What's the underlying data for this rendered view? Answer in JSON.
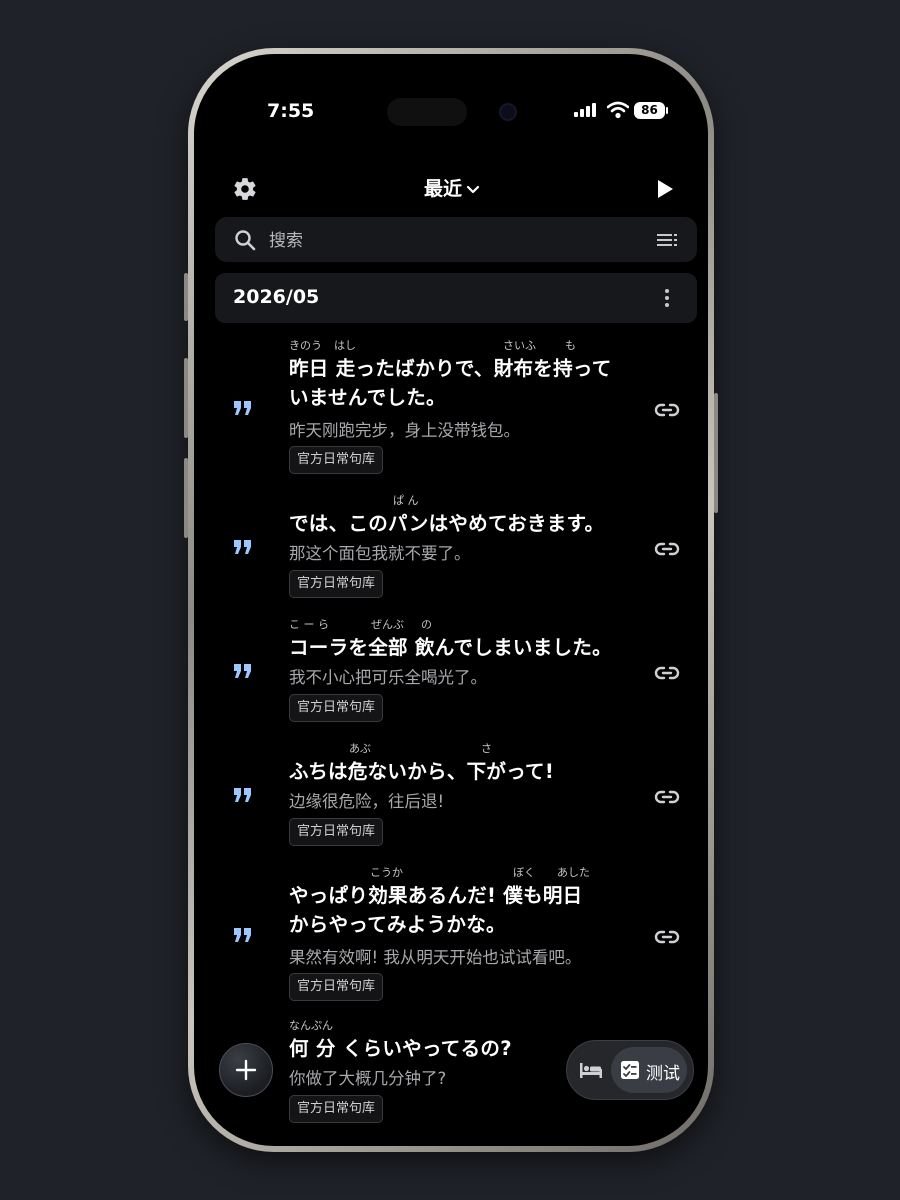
{
  "status_bar": {
    "time": "7:55",
    "battery": "86"
  },
  "header": {
    "title": "最近"
  },
  "search": {
    "placeholder": "搜索"
  },
  "month": {
    "label": "2026/05"
  },
  "sentences": [
    {
      "ruby": [
        "きのう",
        "はし",
        "さいふ",
        "も"
      ],
      "jp_lines": [
        "昨日 走ったばかりで、財布を持って",
        "いませんでした。"
      ],
      "zh": "昨天刚跑完步，身上没带钱包。",
      "tag": "官方日常句库"
    },
    {
      "ruby": [
        "ぱ ん"
      ],
      "jp_lines": [
        "では、このパンはやめておきます。"
      ],
      "zh": "那这个面包我就不要了。",
      "tag": "官方日常句库"
    },
    {
      "ruby": [
        "こ ー ら",
        "ぜんぶ",
        "の"
      ],
      "jp_lines": [
        "コーラを全部 飲んでしまいました。"
      ],
      "zh": "我不小心把可乐全喝光了。",
      "tag": "官方日常句库"
    },
    {
      "ruby": [
        "あぶ",
        "さ"
      ],
      "jp_lines": [
        "ふちは危ないから、下がって!"
      ],
      "zh": "边缘很危险，往后退!",
      "tag": "官方日常句库"
    },
    {
      "ruby": [
        "こうか",
        "ぼく",
        "あした"
      ],
      "jp_lines": [
        "やっぱり効果あるんだ! 僕も明日",
        "からやってみようかな。"
      ],
      "zh": "果然有效啊! 我从明天开始也试试看吧。",
      "tag": "官方日常句库"
    },
    {
      "ruby": [
        "なんぷん"
      ],
      "jp_lines": [
        "何 分 くらいやってるの?"
      ],
      "zh": "你做了大概几分钟了?",
      "tag": "官方日常句库"
    }
  ],
  "bottom": {
    "test_label": "测试"
  },
  "icons": {
    "settings": "gear-icon",
    "title_dropdown": "chevron-down-icon",
    "play": "play-icon",
    "search": "search-icon",
    "list": "list-icon",
    "more": "more-vertical-icon",
    "quote": "quote-icon",
    "link": "link-icon",
    "add": "plus-icon",
    "bed": "bed-icon",
    "test": "checklist-icon"
  },
  "colors": {
    "background": "#000000",
    "quote_accent": "#9ec6ff",
    "panel": "#17181b"
  }
}
